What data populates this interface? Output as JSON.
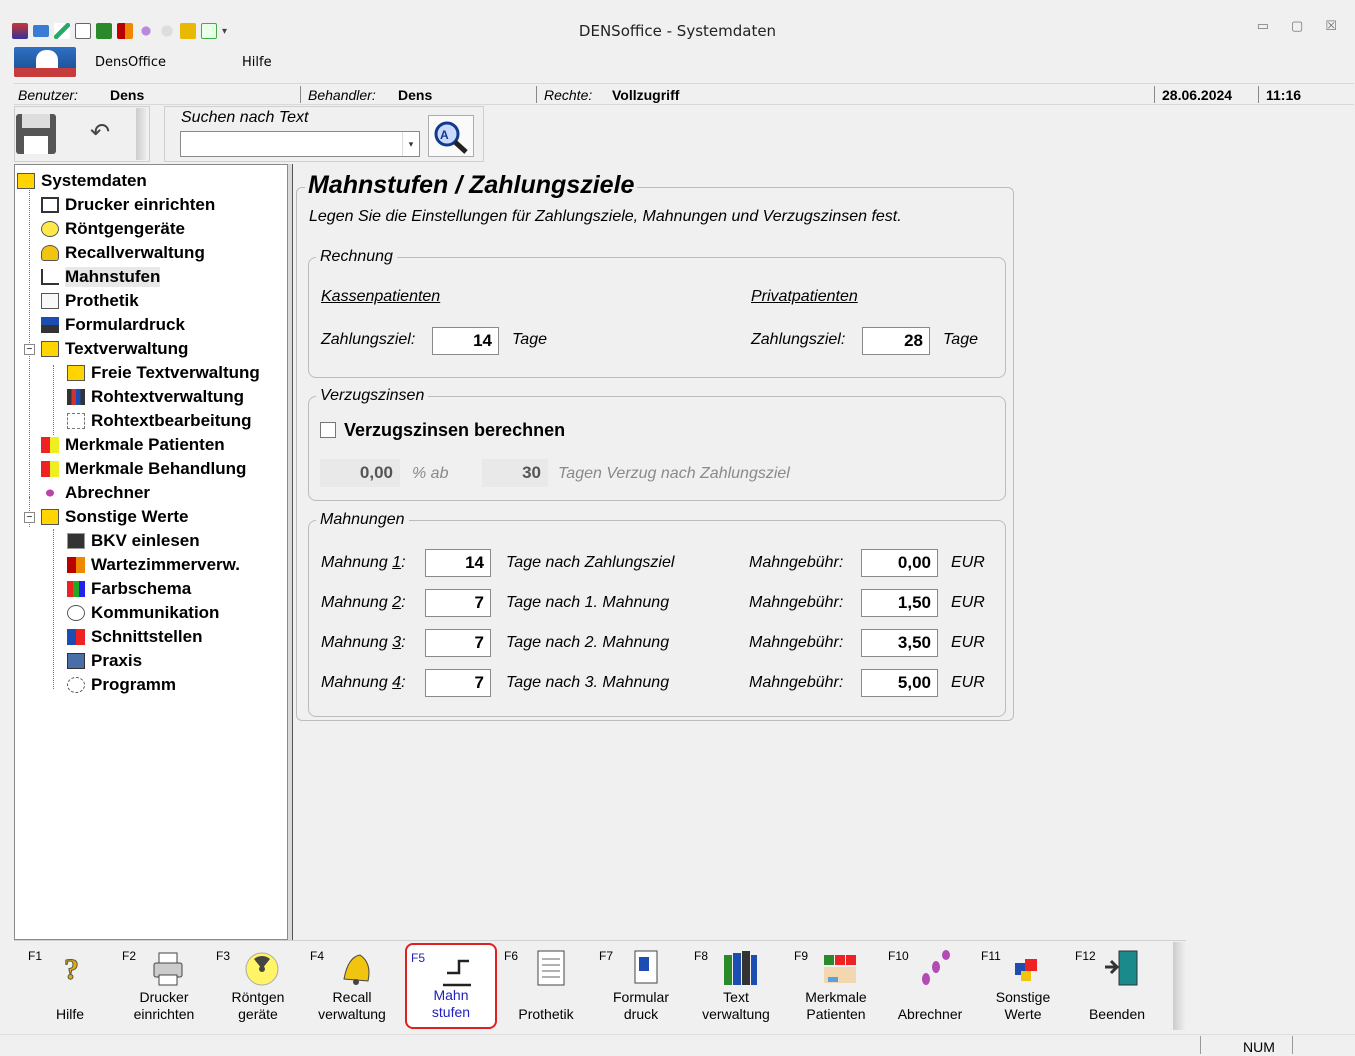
{
  "window": {
    "title": "DENSoffice - Systemdaten",
    "minimize": "▭",
    "maximize": "▢",
    "close": "☒"
  },
  "ribbon_tabs": [
    "DensOffice",
    "Hilfe"
  ],
  "infobar": {
    "user_label": "Benutzer:",
    "user_value": "Dens",
    "practitioner_label": "Behandler:",
    "practitioner_value": "Dens",
    "rights_label": "Rechte:",
    "rights_value": "Vollzugriff",
    "date": "28.06.2024",
    "time": "11:16"
  },
  "toolbar": {
    "undo_glyph": "↶",
    "search_label": "Suchen nach Text",
    "search_value": "",
    "dropdown_glyph": "▾"
  },
  "tree": {
    "root": "Systemdaten",
    "items": [
      "Drucker einrichten",
      "Röntgengeräte",
      "Recallverwaltung",
      "Mahnstufen",
      "Prothetik",
      "Formulardruck",
      "Textverwaltung",
      "Freie Textverwaltung",
      "Rohtextverwaltung",
      "Rohtextbearbeitung",
      "Merkmale Patienten",
      "Merkmale Behandlung",
      "Abrechner",
      "Sonstige Werte",
      "BKV einlesen",
      "Wartezimmerverw.",
      "Farbschema",
      "Kommunikation",
      "Schnittstellen",
      "Praxis",
      "Programm"
    ],
    "expander": "−"
  },
  "main": {
    "title": "Mahnstufen / Zahlungsziele",
    "description": "Legen Sie die Einstellungen für Zahlungsziele, Mahnungen und Verzugszinsen fest.",
    "rechnung": {
      "title": "Rechnung",
      "kassen_label": "Kassenpatienten",
      "privat_label": "Privatpatienten",
      "ziel_label": "Zahlungsziel:",
      "kassen_value": "14",
      "privat_value": "28",
      "unit": "Tage"
    },
    "verzug": {
      "title": "Verzugszinsen",
      "checkbox_label": "Verzugszinsen berechnen",
      "checked": false,
      "rate_value": "0,00",
      "rate_unit": "% ab",
      "days_value": "30",
      "days_unit": "Tagen Verzug nach Zahlungsziel"
    },
    "mahnungen": {
      "title": "Mahnungen",
      "fee_label": "Mahngebühr:",
      "currency": "EUR",
      "rows": [
        {
          "label": "Mahnung ",
          "key": "1",
          "days": "14",
          "after": "Tage nach Zahlungsziel",
          "fee": "0,00"
        },
        {
          "label": "Mahnung ",
          "key": "2",
          "days": "7",
          "after": "Tage nach 1. Mahnung",
          "fee": "1,50"
        },
        {
          "label": "Mahnung ",
          "key": "3",
          "days": "7",
          "after": "Tage nach 2. Mahnung",
          "fee": "3,50"
        },
        {
          "label": "Mahnung ",
          "key": "4",
          "days": "7",
          "after": "Tage nach 3. Mahnung",
          "fee": "5,00"
        }
      ]
    }
  },
  "fkeys": [
    {
      "key": "F1",
      "label": "Hilfe",
      "icon": "help-icon"
    },
    {
      "key": "F2",
      "label": "Drucker\neinrichten",
      "icon": "printer-icon"
    },
    {
      "key": "F3",
      "label": "Röntgen\ngeräte",
      "icon": "radiation-icon"
    },
    {
      "key": "F4",
      "label": "Recall\nverwaltung",
      "icon": "bell-icon"
    },
    {
      "key": "F5",
      "label": "Mahn\nstufen",
      "icon": "reminder-level-icon",
      "active": true
    },
    {
      "key": "F6",
      "label": "Prothetik",
      "icon": "document-icon"
    },
    {
      "key": "F7",
      "label": "Formular\ndruck",
      "icon": "form-print-icon"
    },
    {
      "key": "F8",
      "label": "Text\nverwaltung",
      "icon": "books-icon"
    },
    {
      "key": "F9",
      "label": "Merkmale\nPatienten",
      "icon": "features-icon"
    },
    {
      "key": "F10",
      "label": "Abrechner",
      "icon": "footprints-icon"
    },
    {
      "key": "F11",
      "label": "Sonstige\nWerte",
      "icon": "cubes-icon"
    },
    {
      "key": "F12",
      "label": "Beenden",
      "icon": "exit-door-icon"
    }
  ],
  "statusbar": {
    "num": "NUM"
  },
  "colors": {
    "window_bg": "#f0f0f0",
    "active_fkey_border": "#e02020",
    "active_fkey_text": "#2020c0",
    "folder_yellow": "#ffd400"
  }
}
